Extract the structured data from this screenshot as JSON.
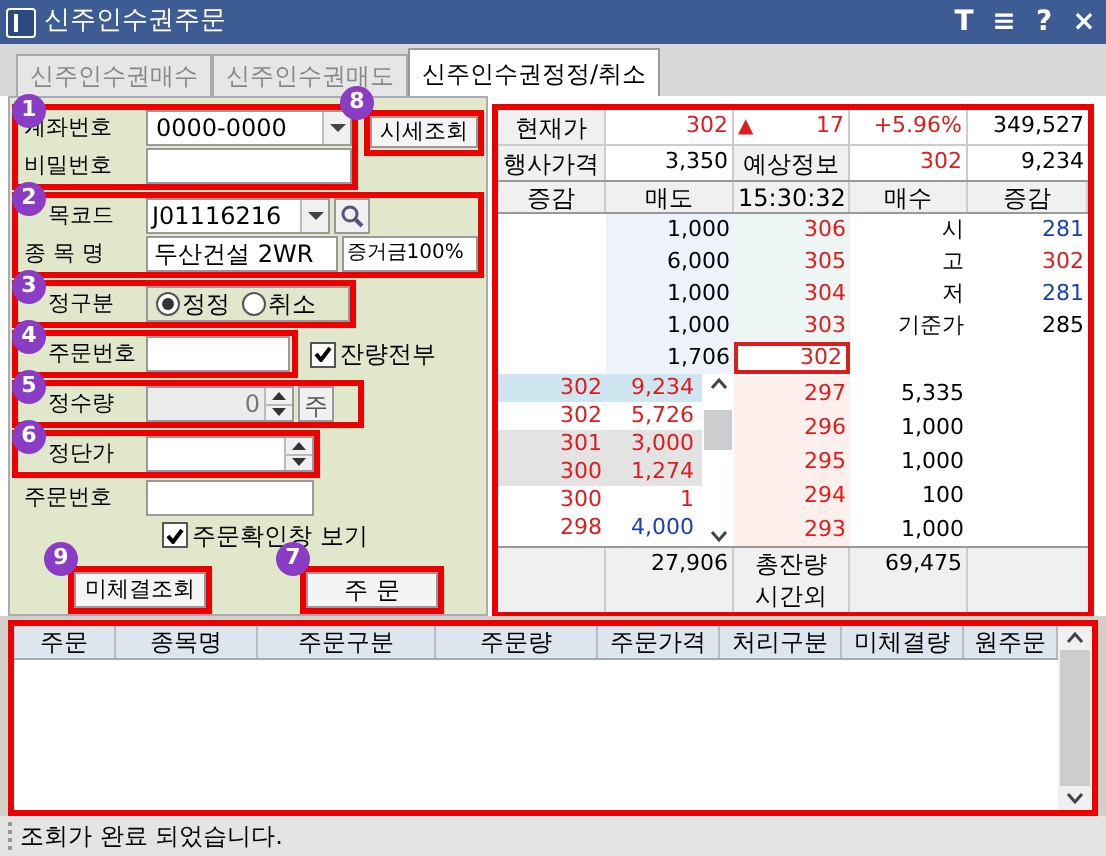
{
  "window": {
    "title": "신주인수권주문",
    "title_buttons": [
      "T",
      "≡",
      "?",
      "×"
    ]
  },
  "tabs": [
    {
      "label": "신주인수권매수",
      "selected": false
    },
    {
      "label": "신주인수권매도",
      "selected": false
    },
    {
      "label": "신주인수권정정/취소",
      "selected": true
    }
  ],
  "form": {
    "account": {
      "badge": "1",
      "label": "계좌번호",
      "value": "0000-0000"
    },
    "password": {
      "label": "비밀번호"
    },
    "quote_button": {
      "badge": "8",
      "label": "시세조회"
    },
    "code": {
      "badge": "2",
      "label": "목코드",
      "value": "J01116216"
    },
    "name": {
      "label": "종 목 명",
      "value": "두산건설 2WR",
      "margin": "증거금100%"
    },
    "order_type": {
      "badge": "3",
      "label": "정구분",
      "options": [
        {
          "label": "정정",
          "selected": true
        },
        {
          "label": "취소",
          "selected": false
        }
      ]
    },
    "original_order": {
      "badge": "4",
      "label": "주문번호"
    },
    "remaining_all": {
      "label": "잔량전부",
      "checked": true
    },
    "quantity": {
      "badge": "5",
      "label": "정수량",
      "value": "0",
      "disabled": true,
      "unit": "주"
    },
    "price": {
      "badge": "6",
      "label": "정단가"
    },
    "order_number": {
      "label": "주문번호"
    },
    "confirm": {
      "label": "주문확인창 보기",
      "checked": true
    },
    "pending_button": {
      "badge": "9",
      "label": "미체결조회"
    },
    "order_button": {
      "badge": "7",
      "label": "주 문"
    }
  },
  "quote": {
    "row_1": [
      "현재가",
      "302",
      "▲",
      "17",
      "+5.96%",
      "349,527"
    ],
    "row_2": [
      "행사가격",
      "3,350",
      "예상정보",
      "302",
      "9,234"
    ],
    "columns": [
      "증감",
      "매도",
      "15:30:32",
      "매수",
      "증감"
    ],
    "asks": [
      {
        "qty": "1,000",
        "price": "306",
        "selected": false
      },
      {
        "qty": "6,000",
        "price": "305",
        "selected": false
      },
      {
        "qty": "1,000",
        "price": "304",
        "selected": false
      },
      {
        "qty": "1,000",
        "price": "303",
        "selected": false
      },
      {
        "qty": "1,706",
        "price": "302",
        "selected": true
      }
    ],
    "info": [
      {
        "label": "시",
        "value": "281",
        "color": "#1a3fb8"
      },
      {
        "label": "고",
        "value": "302",
        "color": "#e01b1b"
      },
      {
        "label": "저",
        "value": "281",
        "color": "#1a3fb8"
      },
      {
        "label": "기준가",
        "value": "285",
        "color": "#000000"
      }
    ],
    "trades": [
      {
        "price": "302",
        "qty": "9,234",
        "color": "#e01b1b",
        "selected": true,
        "shaded": false
      },
      {
        "price": "302",
        "qty": "5,726",
        "color": "#e01b1b",
        "selected": false,
        "shaded": false
      },
      {
        "price": "301",
        "qty": "3,000",
        "color": "#e01b1b",
        "selected": false,
        "shaded": true
      },
      {
        "price": "300",
        "qty": "1,274",
        "color": "#e01b1b",
        "selected": false,
        "shaded": true
      },
      {
        "price": "300",
        "qty": "1",
        "color": "#e01b1b",
        "selected": false,
        "shaded": false
      },
      {
        "price": "298",
        "qty": "4,000",
        "color": "#1a3fb8",
        "selected": false,
        "shaded": false
      }
    ],
    "bids": [
      {
        "price": "297",
        "qty": "5,335"
      },
      {
        "price": "296",
        "qty": "1,000"
      },
      {
        "price": "295",
        "qty": "1,000"
      },
      {
        "price": "294",
        "qty": "100"
      },
      {
        "price": "293",
        "qty": "1,000"
      }
    ],
    "totals": {
      "ask_total": "27,906",
      "label": "총잔량",
      "bid_total": "69,475",
      "after_hours": "시간외"
    }
  },
  "orders_table": {
    "columns": [
      "주문",
      "종목명",
      "주문구분",
      "주문량",
      "주문가격",
      "처리구분",
      "미체결량",
      "원주문"
    ]
  },
  "status_bar": "조회가 완료 되었습니다."
}
